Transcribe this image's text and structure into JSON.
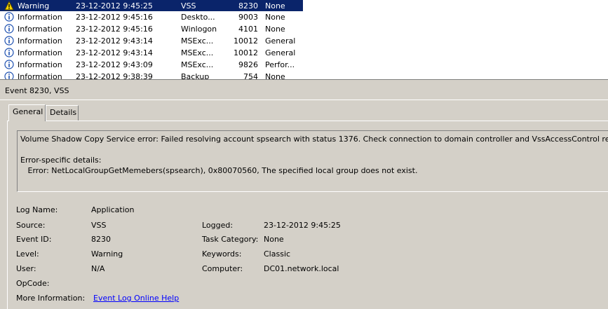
{
  "event_list": {
    "rows": [
      {
        "level": "Warning",
        "date": "23-12-2012 9:45:25",
        "source": "VSS",
        "event_id": "8230",
        "category": "None",
        "icon": "warning-icon",
        "selected": true
      },
      {
        "level": "Information",
        "date": "23-12-2012 9:45:16",
        "source": "Deskto...",
        "event_id": "9003",
        "category": "None",
        "icon": "info-icon",
        "selected": false
      },
      {
        "level": "Information",
        "date": "23-12-2012 9:45:16",
        "source": "Winlogon",
        "event_id": "4101",
        "category": "None",
        "icon": "info-icon",
        "selected": false
      },
      {
        "level": "Information",
        "date": "23-12-2012 9:43:14",
        "source": "MSExc...",
        "event_id": "10012",
        "category": "General",
        "icon": "info-icon",
        "selected": false
      },
      {
        "level": "Information",
        "date": "23-12-2012 9:43:14",
        "source": "MSExc...",
        "event_id": "10012",
        "category": "General",
        "icon": "info-icon",
        "selected": false
      },
      {
        "level": "Information",
        "date": "23-12-2012 9:43:09",
        "source": "MSExc...",
        "event_id": "9826",
        "category": "Perfor...",
        "icon": "info-icon",
        "selected": false
      },
      {
        "level": "Information",
        "date": "23-12-2012 9:38:39",
        "source": "Backup",
        "event_id": "754",
        "category": "None",
        "icon": "info-icon",
        "selected": false
      }
    ]
  },
  "detail": {
    "title": "Event 8230, VSS",
    "tabs": {
      "general": "General",
      "details": "Details"
    },
    "message": {
      "line1": "Volume Shadow Copy Service error: Failed resolving account spsearch with status 1376. Check connection to domain controller and VssAccessControl registry k",
      "line2": "Error-specific details:",
      "line3": "   Error: NetLocalGroupGetMemebers(spsearch), 0x80070560, The specified local group does not exist."
    },
    "labels": {
      "log_name": "Log Name:",
      "source": "Source:",
      "event_id": "Event ID:",
      "level": "Level:",
      "user": "User:",
      "opcode": "OpCode:",
      "more_info": "More Information:",
      "logged": "Logged:",
      "task_category": "Task Category:",
      "keywords": "Keywords:",
      "computer": "Computer:"
    },
    "values": {
      "log_name": "Application",
      "source": "VSS",
      "event_id": "8230",
      "level": "Warning",
      "user": "N/A",
      "opcode": "",
      "more_info_link": "Event Log Online Help",
      "logged": "23-12-2012 9:45:25",
      "task_category": "None",
      "keywords": "Classic",
      "computer": "DC01.network.local"
    }
  },
  "colors": {
    "selection": "#0a246a",
    "link": "#0000ff",
    "window_bg": "#d4d0c8"
  }
}
